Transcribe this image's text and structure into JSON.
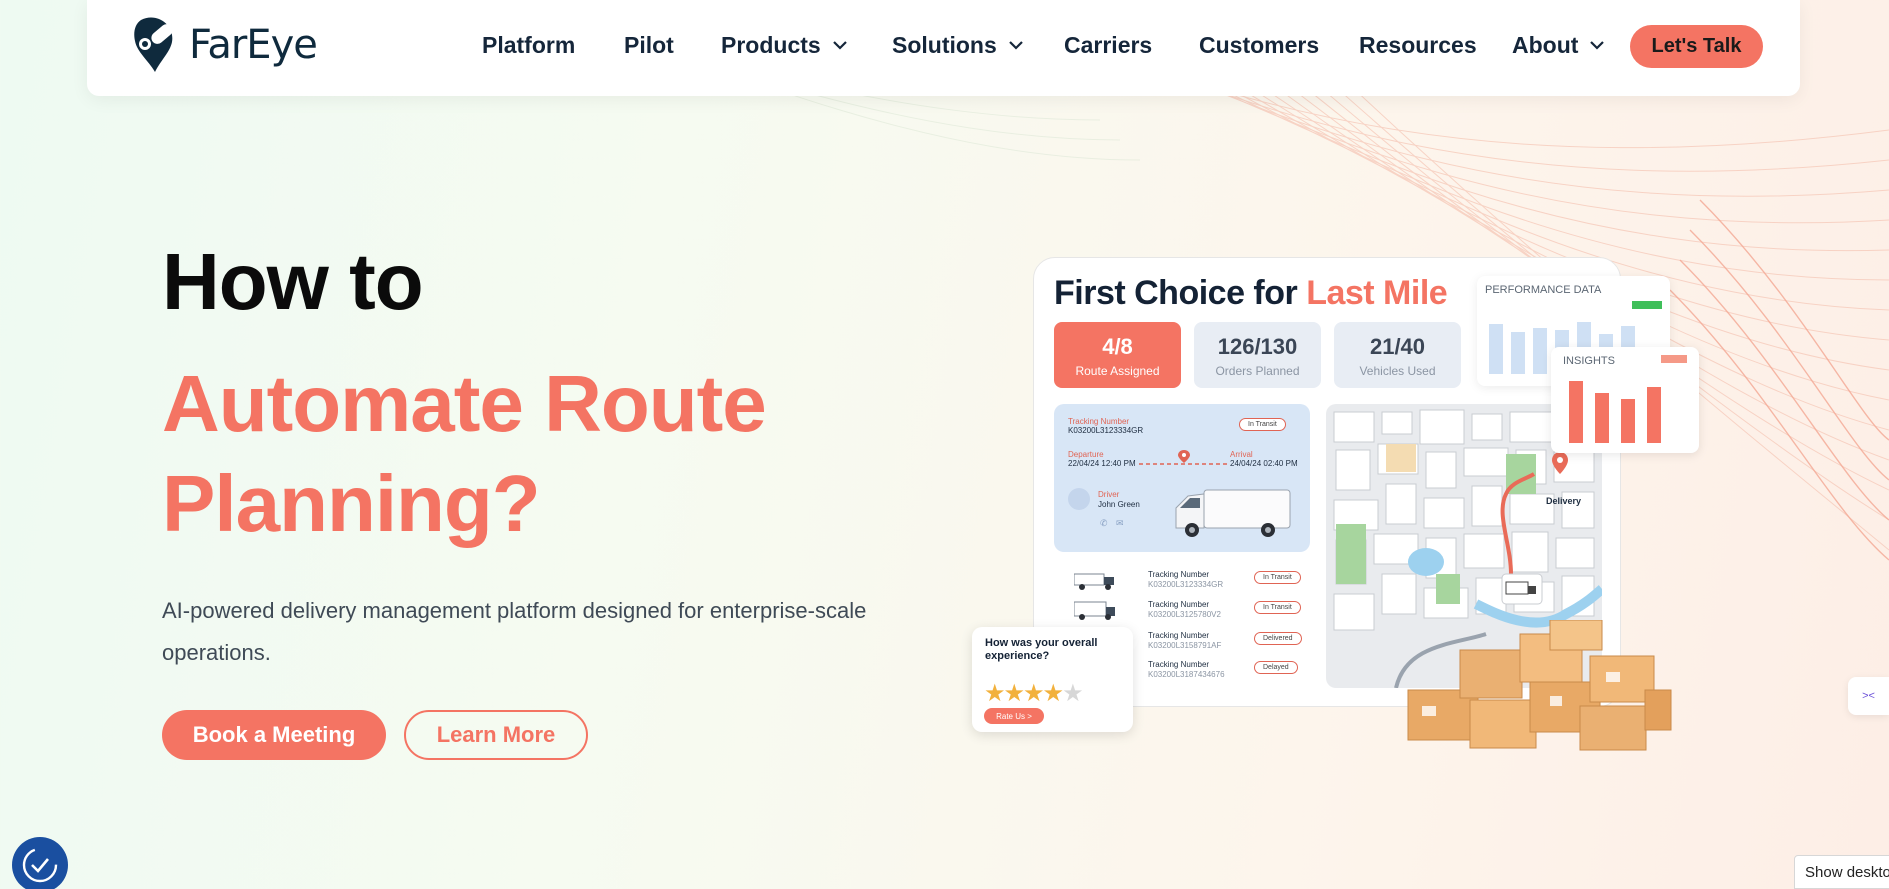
{
  "header": {
    "brand": "FarEye",
    "nav": [
      {
        "label": "Platform"
      },
      {
        "label": "Pilot"
      },
      {
        "label": "Products"
      },
      {
        "label": "Solutions"
      },
      {
        "label": "Carriers"
      },
      {
        "label": "Customers"
      },
      {
        "label": "Resources"
      },
      {
        "label": "About"
      }
    ],
    "cta_label": "Let's Talk"
  },
  "hero": {
    "line1": "How to",
    "line2": "Automate Route",
    "line3": "Planning?",
    "subtitle": "AI-powered delivery management platform designed for enterprise-scale operations.",
    "primary_button": "Book a Meeting",
    "secondary_button": "Learn More"
  },
  "illustration": {
    "title_dark": "First Choice for",
    "title_accent": "Last Mile",
    "stats": [
      {
        "value": "4/8",
        "label": "Route Assigned"
      },
      {
        "value": "126/130",
        "label": "Orders Planned"
      },
      {
        "value": "21/40",
        "label": "Vehicles Used"
      }
    ],
    "tracking": {
      "label": "Tracking Number",
      "number": "K03200L3123334GR",
      "status": "In Transit",
      "departure_label": "Departure",
      "departure_time": "22/04/24 12:40 PM",
      "arrival_label": "Arrival",
      "arrival_time": "24/04/24 02:40 PM",
      "driver_label": "Driver",
      "driver_name": "John Green"
    },
    "rows": [
      {
        "label": "Tracking Number",
        "number": "K03200L3123334GR",
        "status": "In Transit"
      },
      {
        "label": "Tracking Number",
        "number": "K03200L3125780V2",
        "status": "In Transit"
      },
      {
        "label": "Tracking Number",
        "number": "K03200L3158791AF",
        "status": "Delivered"
      },
      {
        "label": "Tracking Number",
        "number": "K03200L3187434676",
        "status": "Delayed"
      }
    ],
    "map_label": "Delivery",
    "performance_title": "PERFORMANCE DATA",
    "insights_title": "INSIGHTS",
    "rating_question": "How was your overall experience?",
    "rating_stars": 4.5,
    "rating_button": "Rate Us >"
  },
  "widgets": {
    "show_desktop": "Show deskto"
  },
  "colors": {
    "accent": "#f47463",
    "navy": "#15263a",
    "accessibility": "#1a4fa0"
  }
}
